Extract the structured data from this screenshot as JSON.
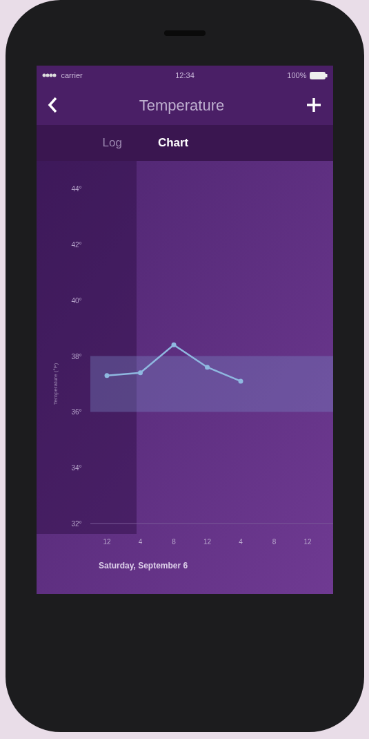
{
  "status_bar": {
    "carrier": "carrier",
    "time": "12:34",
    "battery": "100%"
  },
  "nav": {
    "title": "Temperature"
  },
  "tabs": [
    {
      "label": "Log",
      "selected": false
    },
    {
      "label": "Chart",
      "selected": true
    }
  ],
  "chart_data": {
    "type": "line",
    "ylabel": "Temperature (°F)",
    "ylim": [
      32,
      44
    ],
    "yticks": [
      {
        "value": 44,
        "label": "44°"
      },
      {
        "value": 42,
        "label": "42°"
      },
      {
        "value": 40,
        "label": "40°"
      },
      {
        "value": 38,
        "label": "38°"
      },
      {
        "value": 36,
        "label": "36°"
      },
      {
        "value": 34,
        "label": "34°"
      },
      {
        "value": 32,
        "label": "32°"
      }
    ],
    "categories": [
      "12",
      "4",
      "8",
      "12",
      "4",
      "8",
      "12"
    ],
    "series": [
      {
        "color": "#8fb8e0",
        "marker": true,
        "values": [
          37.3,
          37.4,
          38.4,
          37.6,
          37.1,
          null,
          null
        ]
      }
    ],
    "bands": [
      {
        "axis": "y",
        "from": 36,
        "to": 38,
        "color": "#7a8cc8"
      }
    ]
  },
  "date": "Saturday, September 6"
}
